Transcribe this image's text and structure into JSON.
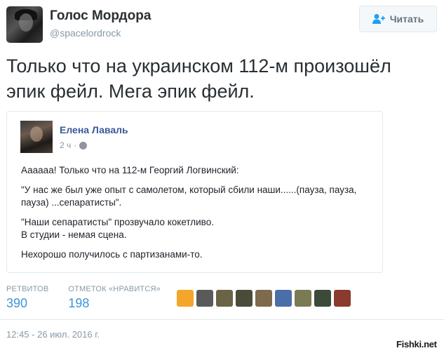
{
  "header": {
    "display_name": "Голос Мордора",
    "handle": "@spacelordrock",
    "follow_label": "Читать"
  },
  "tweet_text_lines": [
    "Только что на украинском 112-м произошёл",
    "эпик фейл. Мега эпик фейл."
  ],
  "quoted_post": {
    "author": "Елена Лаваль",
    "time": "2 ч",
    "paragraphs": [
      "Аааааа! Только что на 112-м Георгий Логвинский:",
      "\"У нас же был уже опыт с самолетом, который сбили наши......(пауза, пауза, пауза) ...сепаратисты\".",
      "\"Наши сепаратисты\" прозвучало кокетливо.\nВ студии - немая сцена.",
      "Нехорошо получилось с партизанами-то."
    ]
  },
  "stats": {
    "retweets_label": "РЕТВИТОВ",
    "retweets_value": "390",
    "likes_label": "ОТМЕТОК «НРАВИТСЯ»",
    "likes_value": "198"
  },
  "likers": [
    {
      "name": "liker-avatar-1",
      "color": "#f4a62a"
    },
    {
      "name": "liker-avatar-2",
      "color": "#5a5a5a"
    },
    {
      "name": "liker-avatar-3",
      "color": "#6b6346"
    },
    {
      "name": "liker-avatar-4",
      "color": "#4b4b3a"
    },
    {
      "name": "liker-avatar-5",
      "color": "#7e6a4c"
    },
    {
      "name": "liker-avatar-6",
      "color": "#4a6ea8"
    },
    {
      "name": "liker-avatar-7",
      "color": "#7a7a55"
    },
    {
      "name": "liker-avatar-8",
      "color": "#3c4a3a"
    },
    {
      "name": "liker-avatar-9",
      "color": "#8a3a2e"
    }
  ],
  "timestamp": "12:45 - 26 июл. 2016 г.",
  "watermark": "Fishki.net"
}
